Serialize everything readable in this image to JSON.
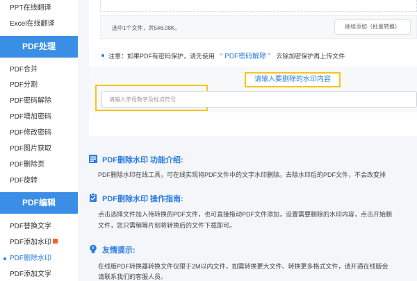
{
  "sidebar": {
    "top_items": [
      "PPT在线翻译",
      "Excel在线翻译"
    ],
    "pdf_process_header": "PDF处理",
    "process_items": [
      "PDF合并",
      "PDF分割",
      "PDF密码解除",
      "PDF增加密码",
      "PDF修改密码",
      "PDF图片获取",
      "PDF删除页",
      "PDF旋转"
    ],
    "pdf_edit_header": "PDF编辑",
    "edit_items": [
      "PDF替换文字",
      "PDF添加水印",
      "PDF删除水印",
      "PDF添加文字"
    ],
    "active_item": "PDF删除水印"
  },
  "upload": {
    "file_info": "选中1个文件，共546.08K。",
    "continue_button": "继续添加（批量转换）"
  },
  "notice": {
    "prefix": "注意：如果PDF有密码保护，请先使用",
    "link": "“ PDF密码解除 ”",
    "suffix": "去除加密保护再上传文件"
  },
  "watermark": {
    "label": "请输入要删除的水印内容",
    "placeholder": "请输入字母数字及标点符号"
  },
  "sections": {
    "intro_title": "PDF删除水印 功能介绍:",
    "intro_text": "PDF删除水印在线工具，可在线实现将PDF文件中的文字水印删除。去除水印后的PDF文件，不会改变排",
    "guide_title": "PDF删除水印 操作指南:",
    "guide_text_1": "点击选择文件加入待转换的PDF文件，也可直接拖动PDF文件添加，设置需要删除的水印内容，点击开始删",
    "guide_text_2": "文件，您只需稍等片刻将转换后的文件下载即可。",
    "tip_title": "友情提示:",
    "tip_text_1": "在线版PDF转换器转换文件仅限于2M以内文件，如需转换更大文件、转换更多格式文件，请开通在线版会",
    "tip_text_2": "请联系我们的客服人员。"
  },
  "colors": {
    "accent": "#2a7de1",
    "sidebar_header": "#3a8ee6",
    "highlight": "#f5c518"
  }
}
